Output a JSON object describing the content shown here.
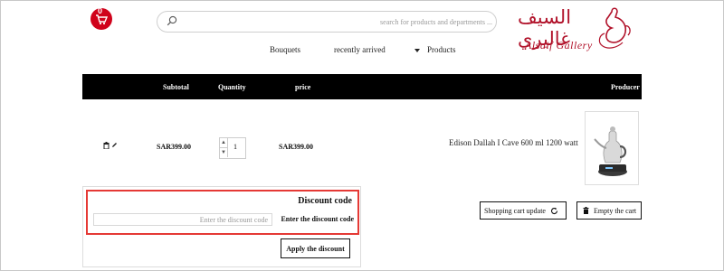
{
  "header": {
    "cart_count": "0",
    "search": {
      "placeholder": "search for products and departments ..."
    },
    "logo": {
      "arabic": "السيف غاليري",
      "english": "Alsaif Gallery"
    }
  },
  "nav": {
    "items": [
      {
        "label": "Bouquets"
      },
      {
        "label": "recently arrived"
      },
      {
        "label": "Products",
        "has_dropdown": true
      }
    ]
  },
  "cart_table": {
    "headers": {
      "subtotal": "Subtotal",
      "quantity": "Quantity",
      "price": "price",
      "producer": "Producer"
    },
    "rows": [
      {
        "subtotal": "SAR399.00",
        "quantity": "1",
        "price": "SAR399.00",
        "product_name": "Edison Dallah I Cave 600 ml 1200 watt"
      }
    ]
  },
  "discount": {
    "title": "Discount code",
    "label": "Enter the discount code",
    "input_placeholder": "Enter the discount code",
    "apply_label": "Apply the discount"
  },
  "actions": {
    "update_label": "Shopping cart update",
    "empty_label": "Empty the cart"
  },
  "colors": {
    "brand_red": "#b1122a",
    "badge_red": "#d0021b",
    "highlight_red": "#e53935",
    "header_black": "#000000"
  }
}
